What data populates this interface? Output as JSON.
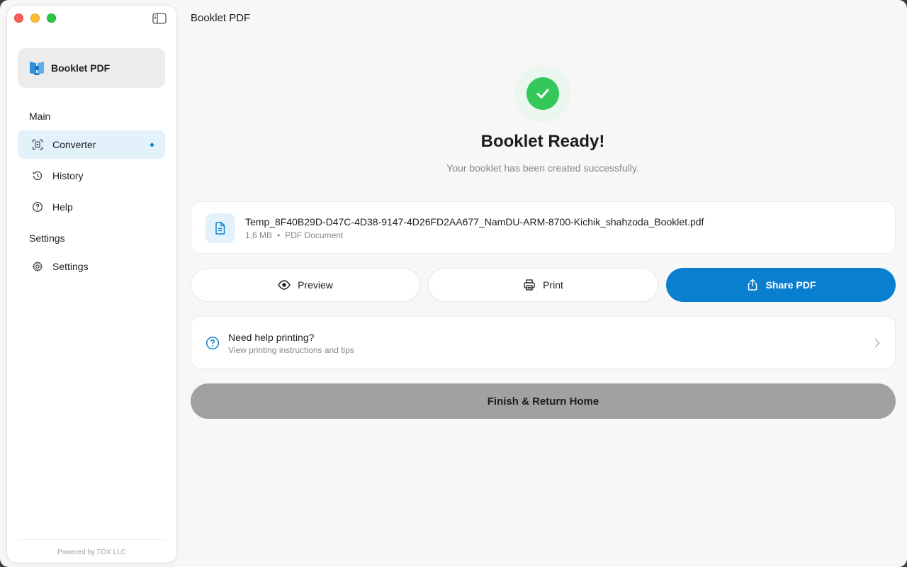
{
  "window": {
    "title": "Booklet PDF"
  },
  "sidebar": {
    "app_name": "Booklet PDF",
    "section_main": "Main",
    "section_settings": "Settings",
    "items": [
      {
        "label": "Converter",
        "icon": "converter-icon",
        "active": true
      },
      {
        "label": "History",
        "icon": "history-icon"
      },
      {
        "label": "Help",
        "icon": "help-icon"
      },
      {
        "label": "Settings",
        "icon": "gear-icon"
      }
    ],
    "footer": "Powered by TOX LLC"
  },
  "main": {
    "headline": "Booklet Ready!",
    "subline": "Your booklet has been created successfully.",
    "file": {
      "name": "Temp_8F40B29D-D47C-4D38-9147-4D26FD2AA677_NamDU-ARM-8700-Kichik_shahzoda_Booklet.pdf",
      "size": "1,6 MB",
      "separator": "•",
      "type": "PDF Document"
    },
    "buttons": {
      "preview": "Preview",
      "print": "Print",
      "share": "Share PDF"
    },
    "help": {
      "title": "Need help printing?",
      "subtitle": "View printing instructions and tips"
    },
    "finish": "Finish & Return Home"
  },
  "colors": {
    "accent": "#0a7fd0",
    "success": "#34c759",
    "active_nav_bg": "#e3f1fb",
    "finish_bg": "#a1a1a1"
  }
}
